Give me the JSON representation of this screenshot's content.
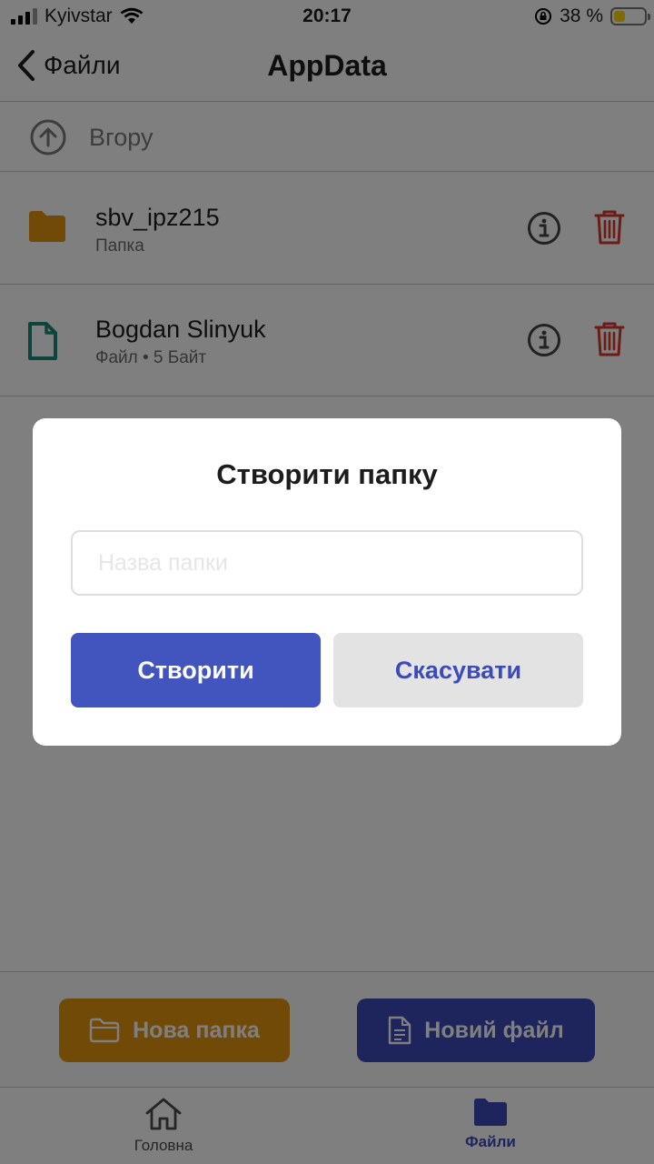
{
  "status_bar": {
    "carrier": "Kyivstar",
    "time": "20:17",
    "battery_percent": "38 %",
    "battery_level": 0.38
  },
  "header": {
    "back_label": "Файли",
    "title": "AppData"
  },
  "up_row": {
    "label": "Вгору"
  },
  "items": [
    {
      "name": "sbv_ipz215",
      "meta": "Папка",
      "icon": "folder-icon"
    },
    {
      "name": "Bogdan Slinyuk",
      "meta": "Файл • 5 Байт",
      "icon": "file-icon"
    }
  ],
  "bottom_actions": {
    "new_folder": "Нова папка",
    "new_file": "Новий файл"
  },
  "tabs": [
    {
      "label": "Головна",
      "icon": "home-icon",
      "active": false
    },
    {
      "label": "Файли",
      "icon": "folder-icon",
      "active": true
    }
  ],
  "modal": {
    "title": "Створити папку",
    "input_placeholder": "Назва папки",
    "input_value": "",
    "create_label": "Створити",
    "cancel_label": "Скасувати"
  },
  "colors": {
    "accent": "#4254bd",
    "folder": "#e59411",
    "file_icon": "#1a8a7a",
    "delete": "#d9382e"
  }
}
